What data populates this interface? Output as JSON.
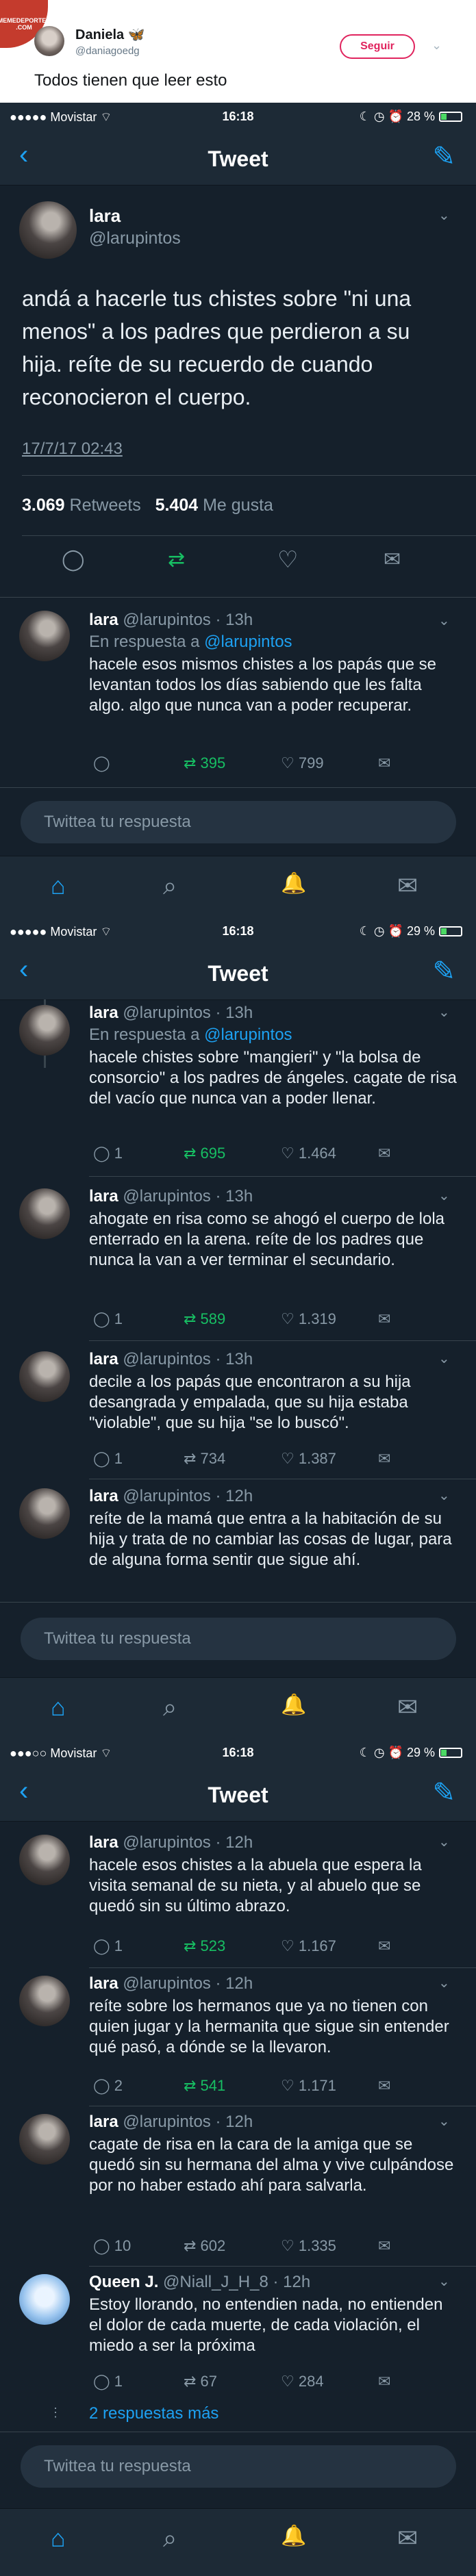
{
  "badge": "MEMEDEPORTES .COM",
  "outer": {
    "name": "Daniela",
    "name_emoji": "🦋",
    "handle": "@daniagoedg",
    "follow": "Seguir",
    "text": "Todos tienen que leer esto"
  },
  "status": [
    {
      "carrier": "●●●●● Movistar ⌔",
      "time": "16:18",
      "right": "☾ ◷ ⏰ 28 %"
    },
    {
      "carrier": "●●●●● Movistar ⌔",
      "time": "16:18",
      "right": "☾ ◷ ⏰ 29 %"
    },
    {
      "carrier": "●●●○○ Movistar ⌔",
      "time": "16:18",
      "right": "☾ ◷ ⏰ 29 %"
    }
  ],
  "nav": {
    "title": "Tweet",
    "back": "‹",
    "compose": "✎"
  },
  "main_tweet": {
    "name": "lara",
    "handle": "@larupintos",
    "text": "andá a hacerle tus chistes sobre \"ni una menos\" a los padres que perdieron a su hija. reíte de su recuerdo de cuando reconocieron el cuerpo.",
    "timestamp": "17/7/17 02:43",
    "retweets_count": "3.069",
    "retweets_label": "Retweets",
    "likes_count": "5.404",
    "likes_label": "Me gusta"
  },
  "reply_placeholder": "Twittea tu respuesta",
  "in_reply": "En respuesta a",
  "more_replies": "2 respuestas más",
  "replies1": [
    {
      "name": "lara",
      "meta": "@larupintos · 13h",
      "in_reply_to": "@larupintos",
      "text": "hacele esos mismos chistes a los papás que se levantan todos los días sabiendo que les falta algo. algo que nunca van a poder recuperar.",
      "comments": "",
      "rts": "395",
      "likes": "799"
    }
  ],
  "replies2": [
    {
      "name": "lara",
      "meta": "@larupintos · 13h",
      "in_reply_to": "@larupintos",
      "text": "hacele chistes sobre \"mangieri\" y \"la bolsa de consorcio\" a los padres de ángeles. cagate de risa del vacío que nunca van a poder llenar.",
      "comments": "1",
      "rts": "695",
      "likes": "1.464"
    },
    {
      "name": "lara",
      "meta": "@larupintos · 13h",
      "text": "ahogate en risa como se ahogó el cuerpo de lola enterrado en la arena. reíte de los padres que nunca la van a ver terminar el secundario.",
      "comments": "1",
      "rts": "589",
      "likes": "1.319"
    },
    {
      "name": "lara",
      "meta": "@larupintos · 13h",
      "text": "decile a los papás que encontraron a su hija desangrada y empalada, que su hija estaba \"violable\", que su hija \"se lo buscó\".",
      "comments": "1",
      "rts": "734",
      "likes": "1.387"
    },
    {
      "name": "lara",
      "meta": "@larupintos · 12h",
      "text": "reíte de la mamá que entra a la habitación de su hija y trata de no cambiar las cosas de lugar, para de alguna forma sentir que sigue ahí.",
      "comments": "",
      "rts": "",
      "likes": ""
    }
  ],
  "replies3": [
    {
      "name": "lara",
      "meta": "@larupintos · 12h",
      "text": "hacele esos chistes a la abuela que espera la visita semanal de su nieta, y al abuelo que se quedó sin su último abrazo.",
      "comments": "1",
      "rts": "523",
      "likes": "1.167"
    },
    {
      "name": "lara",
      "meta": "@larupintos · 12h",
      "text": "reíte sobre los hermanos que ya no tienen con quien jugar y la hermanita que sigue sin entender qué pasó, a dónde se la llevaron.",
      "comments": "2",
      "rts": "541",
      "likes": "1.171"
    },
    {
      "name": "lara",
      "meta": "@larupintos · 12h",
      "text": "cagate de risa en la cara de la amiga que se quedó sin su hermana del alma y vive culpándose por no haber estado ahí para salvarla.",
      "comments": "10",
      "rts": "602",
      "likes": "1.335"
    },
    {
      "name": "Queen J.",
      "meta": "@Niall_J_H_8 · 12h",
      "text": "Estoy llorando, no entendien nada, no entienden el dolor de cada muerte, de cada violación, el miedo a ser la próxima",
      "comments": "1",
      "rts": "67",
      "likes": "284"
    }
  ],
  "icons": {
    "comment": "◯",
    "retweet": "⇄",
    "like": "♡",
    "dm": "✉",
    "chevron": "⌄",
    "home": "⌂",
    "search": "⌕",
    "bell": "🔔",
    "mail": "✉"
  },
  "colors": {
    "bg": "#15202b",
    "accent": "#1da1f2",
    "retweet": "#17bf63",
    "follow": "#e0245e"
  }
}
